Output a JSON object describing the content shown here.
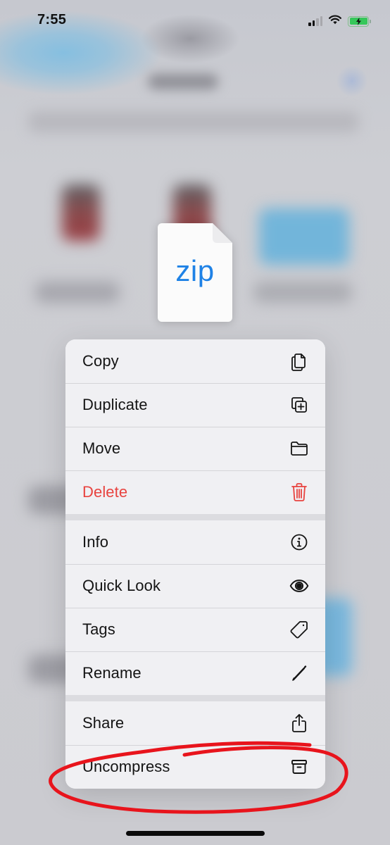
{
  "status_bar": {
    "time": "7:55",
    "signal_bars_active": 2,
    "signal_bars_total": 4,
    "wifi_icon": "wifi-icon",
    "battery_icon": "battery-charging-icon",
    "battery_color": "#35c759"
  },
  "file_preview": {
    "extension": "zip",
    "icon": "zip-document-icon",
    "accent_color": "#1f82e6"
  },
  "context_menu": {
    "groups": [
      {
        "items": [
          {
            "label": "Copy",
            "icon": "copy-icon"
          },
          {
            "label": "Duplicate",
            "icon": "duplicate-icon"
          },
          {
            "label": "Move",
            "icon": "folder-icon"
          },
          {
            "label": "Delete",
            "icon": "trash-icon",
            "destructive": true,
            "color": "#e8433f"
          }
        ]
      },
      {
        "items": [
          {
            "label": "Info",
            "icon": "info-icon"
          },
          {
            "label": "Quick Look",
            "icon": "eye-icon"
          },
          {
            "label": "Tags",
            "icon": "tag-icon"
          },
          {
            "label": "Rename",
            "icon": "pencil-icon"
          }
        ]
      },
      {
        "items": [
          {
            "label": "Share",
            "icon": "share-icon"
          },
          {
            "label": "Uncompress",
            "icon": "archive-box-icon",
            "highlighted": true
          }
        ]
      }
    ]
  },
  "annotation": {
    "type": "hand-drawn-circle",
    "target": "Uncompress",
    "color": "#e8141c"
  }
}
